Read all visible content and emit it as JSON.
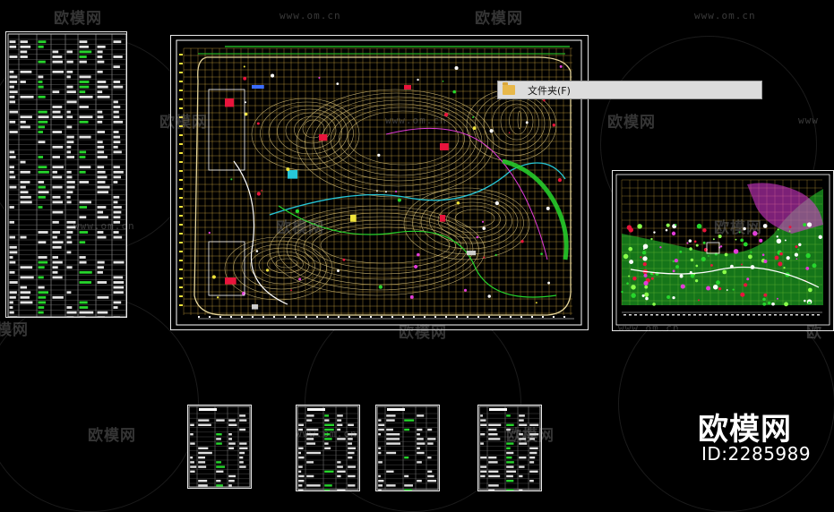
{
  "canvas": {
    "background_color": "#000000"
  },
  "watermarks": {
    "brand": "欧模网",
    "url": "www.om.cn",
    "partial_url": "www",
    "partial_brand": "欧",
    "partial_brand_tail": "模网"
  },
  "popup": {
    "icon": "folder-icon",
    "menu_label": "文件夹(F)"
  },
  "branding": {
    "title": "欧模网",
    "id_text": "ID:2285989"
  },
  "colors": {
    "grid": "#c8a23c",
    "frame": "#ffffff",
    "contour": "#d8c27a",
    "green": "#27d52d",
    "magenta": "#e23bd8",
    "red": "#e8143c",
    "cyan": "#26c7d8",
    "blue": "#3a6cff",
    "yellow": "#f0e33a"
  },
  "drawings": [
    {
      "kind": "plant-schedule-table"
    },
    {
      "kind": "master-site-plan"
    },
    {
      "kind": "planting-detail-plan"
    },
    {
      "kind": "small-legend-table"
    },
    {
      "kind": "small-legend-table"
    },
    {
      "kind": "small-legend-table"
    },
    {
      "kind": "small-legend-table"
    }
  ]
}
